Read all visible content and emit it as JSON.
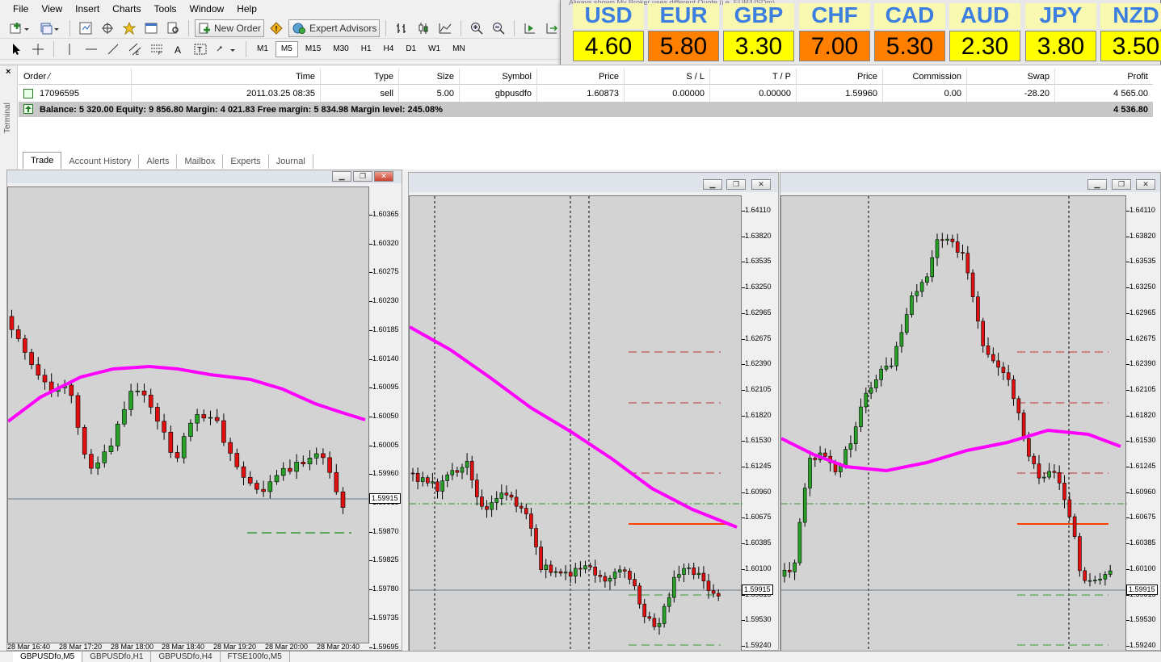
{
  "menu": [
    "File",
    "View",
    "Insert",
    "Charts",
    "Tools",
    "Window",
    "Help"
  ],
  "toolbar": {
    "new_order": "New Order",
    "expert_advisors": "Expert Advisors",
    "timeframes": [
      "M1",
      "M5",
      "M15",
      "M30",
      "H1",
      "H4",
      "D1",
      "W1",
      "MN"
    ],
    "active_timeframe": "M5"
  },
  "strength_panel": {
    "caption": "Always shown    My Broker uses different Quote (i.e. EUR/USDm)",
    "currencies": [
      {
        "code": "USD",
        "value": "4.60",
        "color": "#ffff00"
      },
      {
        "code": "EUR",
        "value": "5.80",
        "color": "#ff8000"
      },
      {
        "code": "GBP",
        "value": "3.30",
        "color": "#ffff00"
      },
      {
        "code": "CHF",
        "value": "7.00",
        "color": "#ff8000"
      },
      {
        "code": "CAD",
        "value": "5.30",
        "color": "#ff8000"
      },
      {
        "code": "AUD",
        "value": "2.30",
        "color": "#ffff00"
      },
      {
        "code": "JPY",
        "value": "3.80",
        "color": "#ffff00"
      },
      {
        "code": "NZD",
        "value": "3.50",
        "color": "#ffff00"
      }
    ]
  },
  "terminal": {
    "side_label": "Terminal",
    "columns": {
      "order": "Order  ⁄",
      "time": "Time",
      "type": "Type",
      "size": "Size",
      "symbol": "Symbol",
      "price": "Price",
      "sl": "S / L",
      "tp": "T / P",
      "price2": "Price",
      "commission": "Commission",
      "swap": "Swap",
      "profit": "Profit"
    },
    "row": {
      "order": "17096595",
      "time": "2011.03.25 08:35",
      "type": "sell",
      "size": "5.00",
      "symbol": "gbpusdfo",
      "price": "1.60873",
      "sl": "0.00000",
      "tp": "0.00000",
      "price2": "1.59960",
      "commission": "0.00",
      "swap": "-28.20",
      "profit": "4 565.00"
    },
    "balance_text": "Balance: 5 320.00  Equity: 9 856.80  Margin: 4 021.83  Free margin: 5 834.98  Margin level: 245.08%",
    "balance_profit": "4 536.80",
    "tabs": [
      "Trade",
      "Account History",
      "Alerts",
      "Mailbox",
      "Experts",
      "Journal"
    ],
    "active_tab": "Trade"
  },
  "charts": [
    {
      "name": "GBPUSDfo,M5",
      "price_labels": [
        "1.60365",
        "1.60320",
        "1.60275",
        "1.60230",
        "1.60185",
        "1.60140",
        "1.60095",
        "1.60050",
        "1.60005",
        "1.59960",
        "1.59915",
        "1.59870",
        "1.59825",
        "1.59780",
        "1.59735",
        "1.59695"
      ],
      "current_price": "1.59915",
      "time_labels": [
        "28 Mar 16:40",
        "28 Mar 17:20",
        "28 Mar 18:00",
        "28 Mar 18:40",
        "28 Mar 19:20",
        "28 Mar 20:00",
        "28 Mar 20:40"
      ]
    },
    {
      "name": "GBPUSDfo,H1",
      "price_labels": [
        "1.64110",
        "1.63820",
        "1.63535",
        "1.63250",
        "1.62965",
        "1.62675",
        "1.62390",
        "1.62105",
        "1.61820",
        "1.61530",
        "1.61245",
        "1.60960",
        "1.60675",
        "1.60385",
        "1.60100",
        "1.59815",
        "1.59530",
        "1.59240"
      ],
      "current_price": "1.59915"
    },
    {
      "name": "GBPUSDfo,H4",
      "price_labels": [
        "1.64110",
        "1.63820",
        "1.63535",
        "1.63250",
        "1.62965",
        "1.62675",
        "1.62390",
        "1.62105",
        "1.61820",
        "1.61530",
        "1.61245",
        "1.60960",
        "1.60675",
        "1.60385",
        "1.60100",
        "1.59815",
        "1.59530",
        "1.59240"
      ],
      "current_price": "1.59915"
    }
  ],
  "bottom_tabs": [
    "GBPUSDfo,M5",
    "GBPUSDfo,H1",
    "GBPUSDfo,H4",
    "FTSE100fo,M5"
  ],
  "active_bottom_tab": "GBPUSDfo,M5",
  "colors": {
    "ma": "#ff00ff",
    "bull": "#28a028",
    "bear": "#e01010",
    "orange_line": "#ff4000",
    "green_dash": "#50a050",
    "red_dash": "#c03030"
  }
}
